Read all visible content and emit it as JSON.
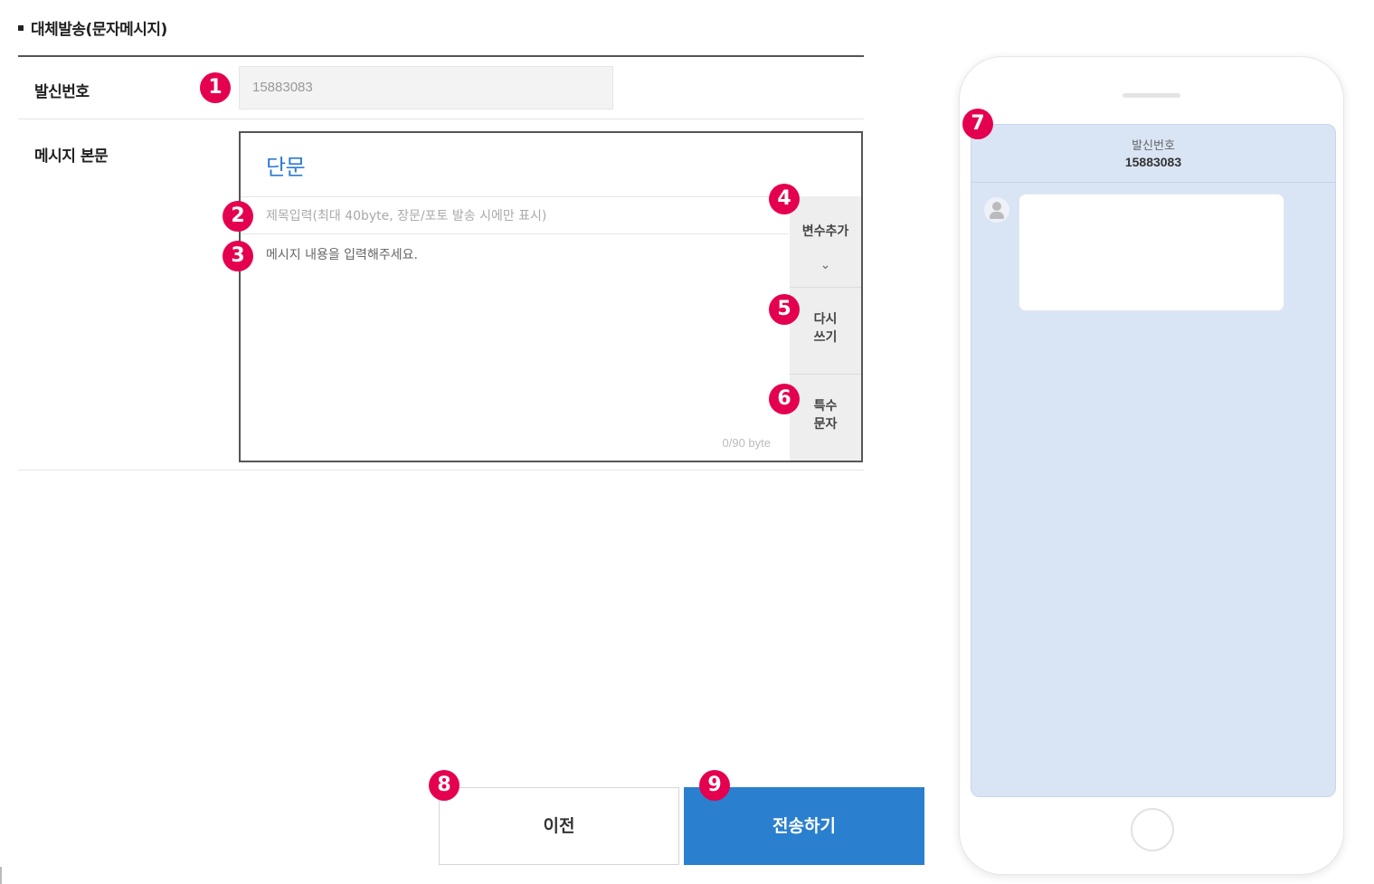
{
  "section": {
    "title": "대체발송(문자메시지)"
  },
  "sender": {
    "label": "발신번호",
    "value": "15883083"
  },
  "message": {
    "label": "메시지 본문",
    "type": "단문",
    "subject_placeholder": "제목입력(최대 40byte, 장문/포토 발송 시에만 표시)",
    "body_placeholder": "메시지 내용을 입력해주세요.",
    "byte_count": "0/90 byte"
  },
  "side_buttons": {
    "add_variable": "변수추가",
    "add_variable_chevron": "⌄",
    "rewrite": "다시\n쓰기",
    "special_chars": "특수\n문자"
  },
  "badges": [
    "1",
    "2",
    "3",
    "4",
    "5",
    "6",
    "7",
    "8",
    "9"
  ],
  "preview": {
    "sender_label": "발신번호",
    "sender_number": "15883083"
  },
  "actions": {
    "prev": "이전",
    "send": "전송하기"
  },
  "colors": {
    "badge": "#e4004f",
    "accent_blue": "#2a7fce",
    "preview_bg": "#d9e5f5",
    "type_text": "#2c7bd4"
  }
}
